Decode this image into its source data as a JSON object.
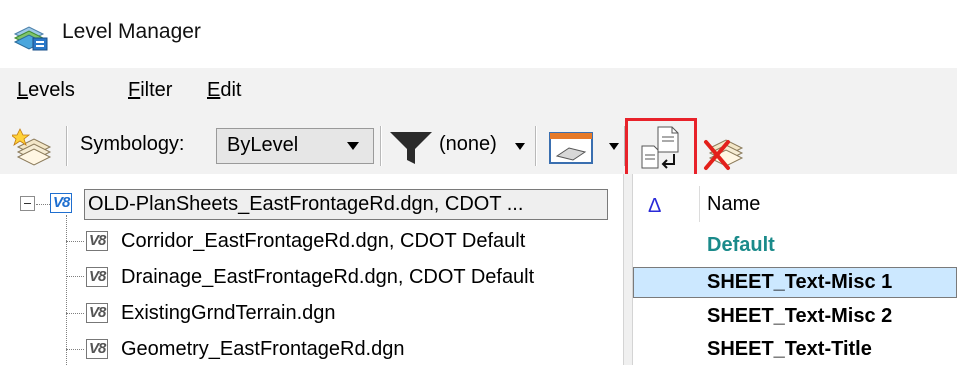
{
  "window": {
    "title": "Level Manager",
    "icon": "level-manager-icon"
  },
  "menu": {
    "items": [
      {
        "label": "Levels",
        "underline": "L",
        "rest": "evels"
      },
      {
        "label": "Filter",
        "underline": "F",
        "rest": "ilter"
      },
      {
        "label": "Edit",
        "underline": "E",
        "rest": "dit"
      }
    ]
  },
  "toolbar": {
    "symbology_label": "Symbology:",
    "symbology_value": "ByLevel",
    "filter_value": "(none)",
    "highlighted_color": "#e8222a"
  },
  "tree": {
    "root": {
      "badge": "V8",
      "label": "OLD-PlanSheets_EastFrontageRd.dgn, CDOT ..."
    },
    "children": [
      {
        "badge": "V8",
        "label": "Corridor_EastFrontageRd.dgn, CDOT Default"
      },
      {
        "badge": "V8",
        "label": "Drainage_EastFrontageRd.dgn, CDOT Default"
      },
      {
        "badge": "V8",
        "label": "ExistingGrndTerrain.dgn"
      },
      {
        "badge": "V8",
        "label": "Geometry_EastFrontageRd.dgn"
      }
    ]
  },
  "levels": {
    "sort_indicator": "Δ",
    "column_header": "Name",
    "rows": [
      {
        "name": "Default"
      },
      {
        "name": "SHEET_Text-Misc 1"
      },
      {
        "name": "SHEET_Text-Misc 2"
      },
      {
        "name": "SHEET_Text-Title"
      }
    ]
  }
}
